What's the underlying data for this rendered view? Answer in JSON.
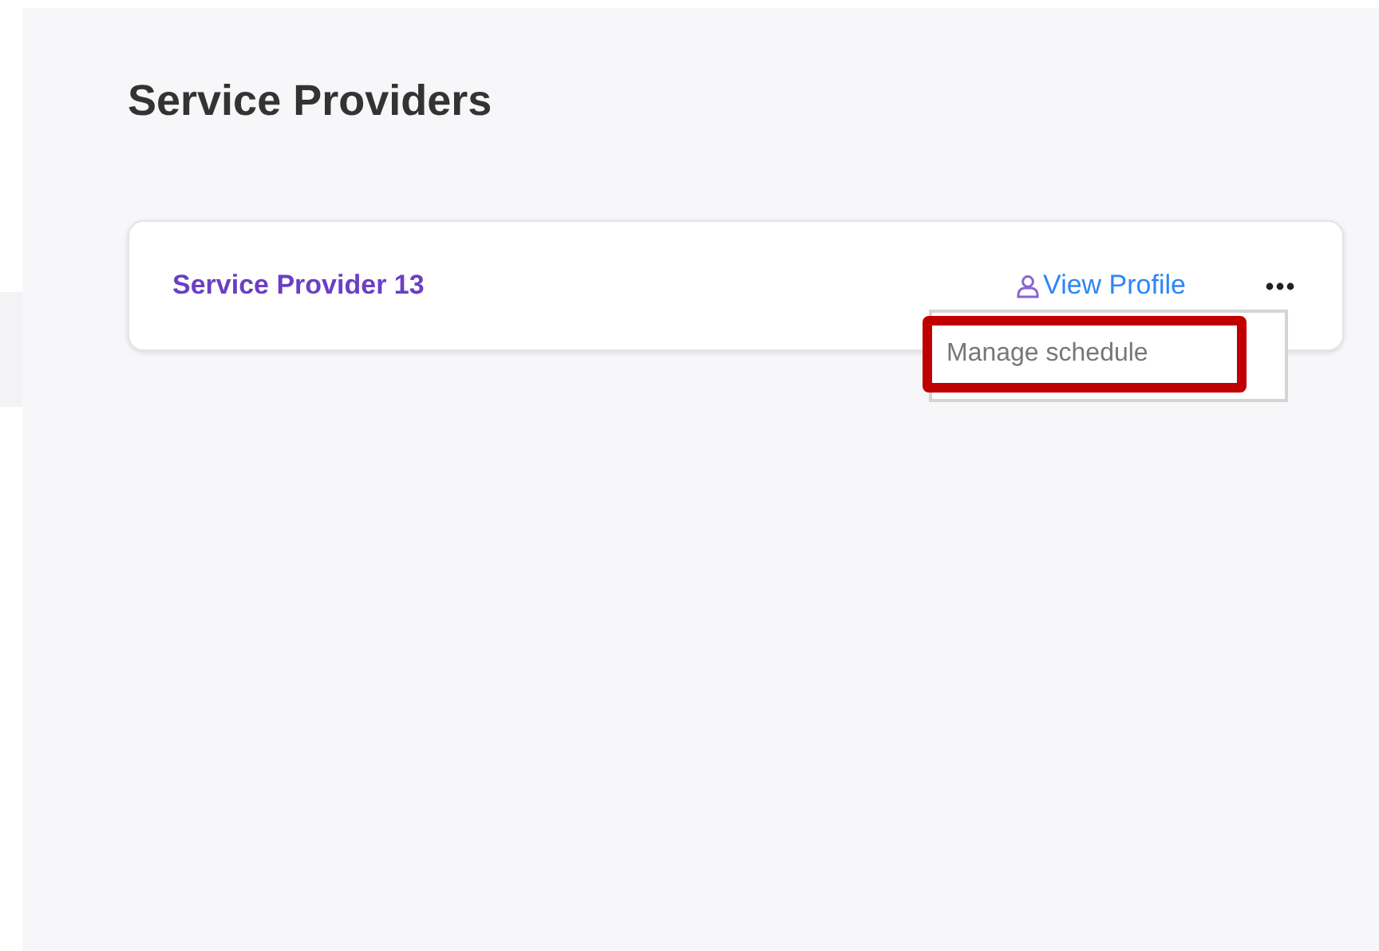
{
  "page": {
    "title": "Service Providers"
  },
  "providers": [
    {
      "name": "Service Provider 13",
      "view_profile": "View Profile",
      "menu_open": true,
      "menu_items": [
        {
          "label": "Manage schedule",
          "highlighted": true
        }
      ]
    }
  ]
}
